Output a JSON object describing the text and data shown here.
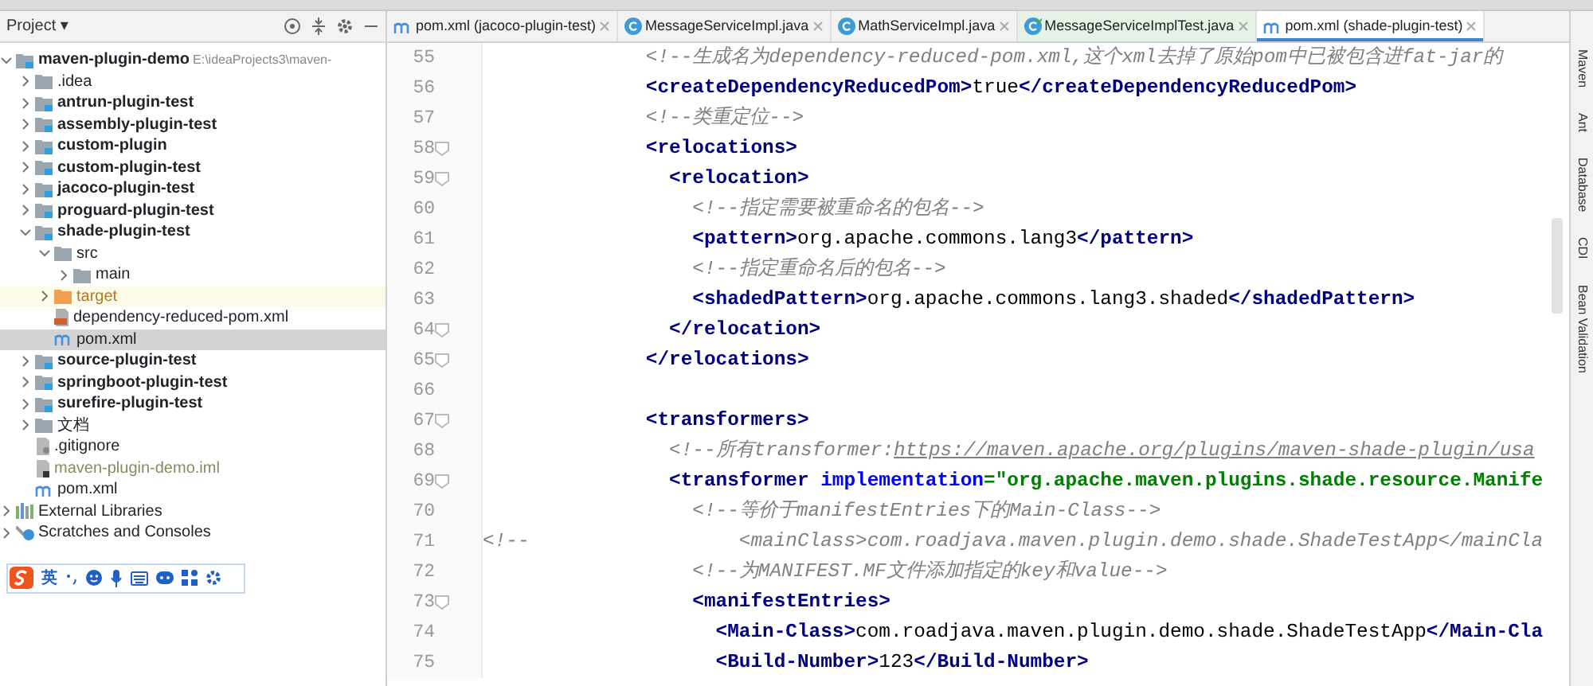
{
  "project_panel": {
    "title": "Project ▾",
    "tree": [
      {
        "label": "maven-plugin-demo",
        "kind": "module",
        "hint": "E:\\ideaProjects3\\maven-",
        "expanded": true,
        "selected": false,
        "excluded": false,
        "children": [
          {
            "label": ".idea",
            "kind": "folder",
            "expanded": false,
            "selected": false,
            "excluded": false
          },
          {
            "label": "antrun-plugin-test",
            "kind": "module",
            "expanded": false,
            "selected": false,
            "excluded": false
          },
          {
            "label": "assembly-plugin-test",
            "kind": "module",
            "expanded": false,
            "selected": false,
            "excluded": false
          },
          {
            "label": "custom-plugin",
            "kind": "module",
            "expanded": false,
            "selected": false,
            "excluded": false
          },
          {
            "label": "custom-plugin-test",
            "kind": "module",
            "expanded": false,
            "selected": false,
            "excluded": false
          },
          {
            "label": "jacoco-plugin-test",
            "kind": "module",
            "expanded": false,
            "selected": false,
            "excluded": false
          },
          {
            "label": "proguard-plugin-test",
            "kind": "module",
            "expanded": false,
            "selected": false,
            "excluded": false
          },
          {
            "label": "shade-plugin-test",
            "kind": "module",
            "expanded": true,
            "selected": false,
            "excluded": false,
            "children": [
              {
                "label": "src",
                "kind": "folder",
                "expanded": true,
                "selected": false,
                "excluded": false,
                "children": [
                  {
                    "label": "main",
                    "kind": "folder",
                    "expanded": false,
                    "selected": false,
                    "excluded": false
                  }
                ]
              },
              {
                "label": "target",
                "kind": "folder",
                "expanded": false,
                "selected": false,
                "excluded": true
              },
              {
                "label": "dependency-reduced-pom.xml",
                "kind": "xml",
                "selected": false,
                "excluded": false
              },
              {
                "label": "pom.xml",
                "kind": "maven",
                "selected": true,
                "excluded": false
              }
            ]
          },
          {
            "label": "source-plugin-test",
            "kind": "module",
            "expanded": false,
            "selected": false,
            "excluded": false
          },
          {
            "label": "springboot-plugin-test",
            "kind": "module",
            "expanded": false,
            "selected": false,
            "excluded": false
          },
          {
            "label": "surefire-plugin-test",
            "kind": "module",
            "expanded": false,
            "selected": false,
            "excluded": false
          },
          {
            "label": "文档",
            "kind": "folder",
            "expanded": false,
            "selected": false,
            "excluded": false
          },
          {
            "label": ".gitignore",
            "kind": "file",
            "selected": false,
            "excluded": false
          },
          {
            "label": "maven-plugin-demo.iml",
            "kind": "iml",
            "selected": false,
            "excluded": false
          },
          {
            "label": "pom.xml",
            "kind": "maven",
            "selected": false,
            "excluded": false
          }
        ]
      },
      {
        "label": "External Libraries",
        "kind": "libraries",
        "expanded": false,
        "selected": false,
        "excluded": false
      },
      {
        "label": "Scratches and Consoles",
        "kind": "scratches",
        "expanded": false,
        "selected": false,
        "excluded": false
      }
    ]
  },
  "ime_toolbar": {
    "mode": "英"
  },
  "tabs": [
    {
      "label": "pom.xml (jacoco-plugin-test)",
      "kind": "maven",
      "selected": false
    },
    {
      "label": "MessageServiceImpl.java",
      "kind": "class",
      "selected": false
    },
    {
      "label": "MathServiceImpl.java",
      "kind": "class",
      "selected": false
    },
    {
      "label": "MessageServiceImplTest.java",
      "kind": "test",
      "selected": false
    },
    {
      "label": "pom.xml (shade-plugin-test)",
      "kind": "maven",
      "selected": true
    }
  ],
  "editor": {
    "lines": [
      {
        "number": "55",
        "segments": [
          {
            "kind": "comment",
            "text": "              <!--生成名为dependency-reduced-pom.xml,这个xml去掉了原始pom中已被包含进fat-jar的"
          }
        ]
      },
      {
        "number": "56",
        "segments": [
          {
            "kind": "tag",
            "text": "              <createDependencyReducedPom>"
          },
          {
            "kind": "plain",
            "text": "true"
          },
          {
            "kind": "tag",
            "text": "</createDependencyReducedPom>"
          }
        ]
      },
      {
        "number": "57",
        "segments": [
          {
            "kind": "comment",
            "text": "              <!--类重定位-->"
          }
        ]
      },
      {
        "number": "58",
        "fold": true,
        "segments": [
          {
            "kind": "tag",
            "text": "              <relocations>"
          }
        ]
      },
      {
        "number": "59",
        "fold": true,
        "segments": [
          {
            "kind": "tag",
            "text": "                <relocation>"
          }
        ]
      },
      {
        "number": "60",
        "segments": [
          {
            "kind": "comment",
            "text": "                  <!--指定需要被重命名的包名-->"
          }
        ]
      },
      {
        "number": "61",
        "segments": [
          {
            "kind": "tag",
            "text": "                  <pattern>"
          },
          {
            "kind": "plain",
            "text": "org.apache.commons.lang3"
          },
          {
            "kind": "tag",
            "text": "</pattern>"
          }
        ]
      },
      {
        "number": "62",
        "segments": [
          {
            "kind": "comment",
            "text": "                  <!--指定重命名后的包名-->"
          }
        ]
      },
      {
        "number": "63",
        "segments": [
          {
            "kind": "tag",
            "text": "                  <shadedPattern>"
          },
          {
            "kind": "plain",
            "text": "org.apache.commons.lang3.shaded"
          },
          {
            "kind": "tag",
            "text": "</shadedPattern>"
          }
        ]
      },
      {
        "number": "64",
        "fold": true,
        "segments": [
          {
            "kind": "tag",
            "text": "                </relocation>"
          }
        ]
      },
      {
        "number": "65",
        "fold": true,
        "segments": [
          {
            "kind": "tag",
            "text": "              </relocations>"
          }
        ]
      },
      {
        "number": "66"
      },
      {
        "number": "67",
        "fold": true,
        "segments": [
          {
            "kind": "tag",
            "text": "              <transformers>"
          }
        ]
      },
      {
        "number": "68",
        "segments": [
          {
            "kind": "comment",
            "text": "                <!--所有transformer:"
          },
          {
            "kind": "link",
            "text": "https://maven.apache.org/plugins/maven-shade-plugin/usa"
          }
        ]
      },
      {
        "number": "69",
        "fold": true,
        "segments": [
          {
            "kind": "tag",
            "text": "                <transformer "
          },
          {
            "kind": "attr",
            "text": "implementation"
          },
          {
            "kind": "string",
            "text": "=\"org.apache.maven.plugins.shade.resource.Manife"
          }
        ]
      },
      {
        "number": "70",
        "segments": [
          {
            "kind": "comment",
            "text": "                  <!--等价于manifestEntries下的Main-Class-->"
          }
        ]
      },
      {
        "number": "71",
        "segments": [
          {
            "kind": "comment",
            "text": "<!--                  <mainClass>com.roadjava.maven.plugin.demo.shade.ShadeTestApp</mainCla"
          }
        ]
      },
      {
        "number": "72",
        "segments": [
          {
            "kind": "comment",
            "text": "                  <!--为MANIFEST.MF文件添加指定的key和value-->"
          }
        ]
      },
      {
        "number": "73",
        "fold": true,
        "segments": [
          {
            "kind": "tag",
            "text": "                  <manifestEntries>"
          }
        ]
      },
      {
        "number": "74",
        "segments": [
          {
            "kind": "tag",
            "text": "                    <Main-Class>"
          },
          {
            "kind": "plain",
            "text": "com.roadjava.maven.plugin.demo.shade.ShadeTestApp"
          },
          {
            "kind": "tag",
            "text": "</Main-Cla"
          }
        ]
      },
      {
        "number": "75",
        "segments": [
          {
            "kind": "tag",
            "text": "                    <Build-Number>"
          },
          {
            "kind": "plain",
            "text": "123"
          },
          {
            "kind": "tag",
            "text": "</Build-Number>"
          }
        ]
      }
    ]
  },
  "right_strip": [
    "Maven",
    "Ant",
    "Database",
    "CDI",
    "Bean Validation"
  ]
}
